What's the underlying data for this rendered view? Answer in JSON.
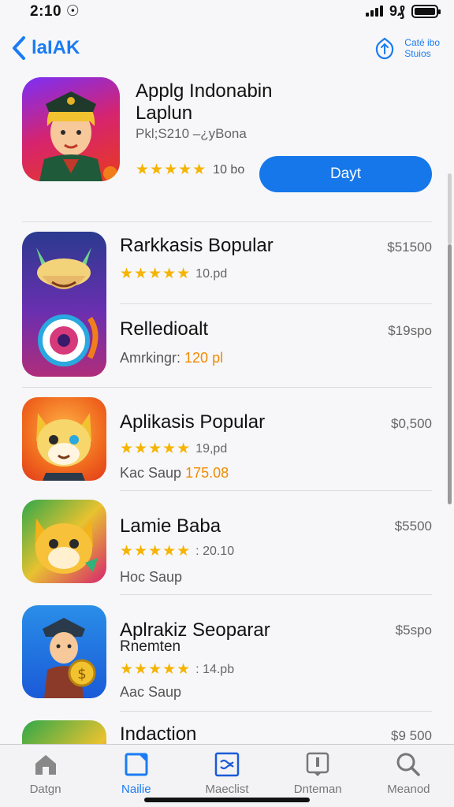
{
  "status": {
    "time": "2:10 ☉",
    "battery_text": "9₰"
  },
  "nav": {
    "back_label": "laIAK",
    "right_line1": "Caté ibo",
    "right_line2": "Stuios"
  },
  "featured": {
    "title_line1": "Applg Indonabin",
    "title_line2": "Laplun",
    "subtitle": "Pkl;S210 –¿yBona",
    "stars": "★★★★★",
    "rating_count": "10 bo",
    "button_label": "Dayt"
  },
  "apps": [
    {
      "name": "Rarkkasis Bopular",
      "price": "$51500",
      "stars": "★★★★★",
      "rating": "10.pd"
    },
    {
      "name": "Relledioalt",
      "price": "$19spo",
      "sub_text": "Amrkingr:",
      "sub_accent": "120 pl"
    },
    {
      "name": "Aplikasis Popular",
      "price": "$0,500",
      "stars": "★★★★★",
      "rating": "19,pd",
      "sub_text": "Kac Saup",
      "sub_accent": "175.08"
    },
    {
      "name": "Lamie Baba",
      "price": "$5500",
      "stars": "★★★★★",
      "rating": ": 20.10",
      "sub_text": "Hoc Saup"
    },
    {
      "name": "Aplrakiz Seoparar",
      "name_line2": "Rnemten",
      "price": "$5spo",
      "stars": "★★★★★",
      "rating": ": 14.pb",
      "sub_text": "Aac Saup"
    },
    {
      "name": "Indaction",
      "price": "$9 500"
    }
  ],
  "tabs": [
    {
      "label": "Datgn",
      "icon": "home-icon"
    },
    {
      "label": "Nailie",
      "icon": "today-icon",
      "active": true
    },
    {
      "label": "Maeclist",
      "icon": "apps-icon"
    },
    {
      "label": "Dnteman",
      "icon": "arcade-icon"
    },
    {
      "label": "Meanod",
      "icon": "search-icon"
    }
  ],
  "colors": {
    "accent": "#1577ea",
    "star": "#f5b400",
    "orange_accent": "#f08a00"
  }
}
